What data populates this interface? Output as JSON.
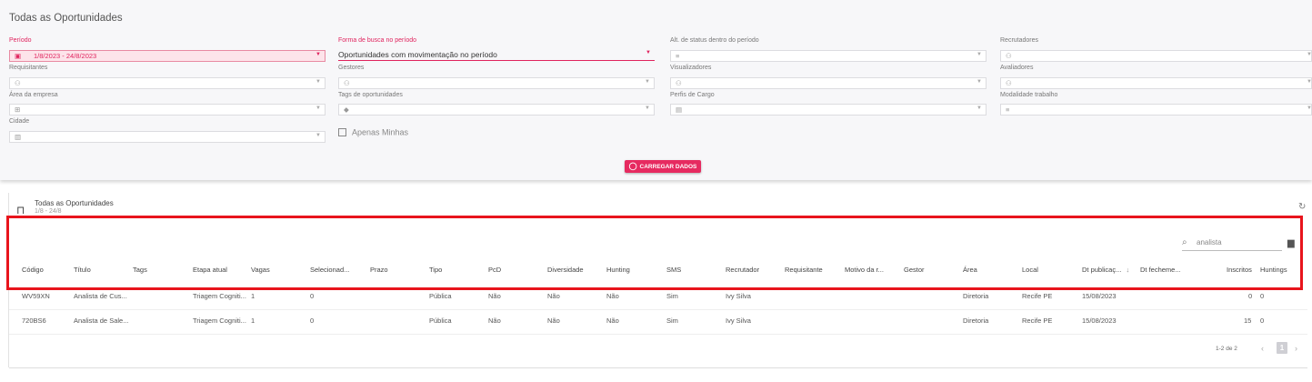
{
  "page": {
    "title": "Todas as Oportunidades"
  },
  "filters": {
    "periodo": {
      "label": "Período",
      "value": "1/8/2023 - 24/8/2023",
      "icon": "calendar-icon"
    },
    "forma_busca": {
      "label": "Forma de busca no período",
      "value": "Oportunidades com movimentação no período"
    },
    "alt_status": {
      "label": "Alt. de status dentro do período",
      "icon": "list-icon"
    },
    "recrutadores": {
      "label": "Recrutadores",
      "icon": "people-icon"
    },
    "requisitantes": {
      "label": "Requisitantes",
      "icon": "people-icon"
    },
    "gestores": {
      "label": "Gestores",
      "icon": "people-icon"
    },
    "visualizadores": {
      "label": "Visualizadores",
      "icon": "people-icon"
    },
    "avaliadores": {
      "label": "Avaliadores",
      "icon": "people-icon"
    },
    "area_empresa": {
      "label": "Área da empresa",
      "icon": "org-icon"
    },
    "tags": {
      "label": "Tags de oportunidades",
      "icon": "tag-icon"
    },
    "perfis": {
      "label": "Perfis de Cargo",
      "icon": "id-card-icon"
    },
    "modalidade": {
      "label": "Modalidade trabalho",
      "icon": "list-icon"
    },
    "cidade": {
      "label": "Cidade",
      "icon": "building-icon"
    },
    "apenas_minhas": {
      "label": "Apenas Minhas",
      "checked": false
    },
    "load_button": "CARREGAR DADOS"
  },
  "list": {
    "title": "Todas as Oportunidades",
    "subtitle": "1/8 - 24/8",
    "search_value": "analista",
    "headers": [
      "Código",
      "Título",
      "Tags",
      "Etapa atual",
      "Vagas",
      "Selecionad...",
      "Prazo",
      "Tipo",
      "PcD",
      "Diversidade",
      "Hunting",
      "SMS",
      "Recrutador",
      "Requisitante",
      "Motivo da r...",
      "Gestor",
      "Área",
      "Local",
      "Dt publicaç...",
      "Dt fecheme...",
      "Inscritos",
      "Huntings"
    ],
    "sorted_column": "Dt publicaç...",
    "rows": [
      {
        "codigo": "WV59XN",
        "titulo": "Analista de Cus...",
        "etapa": "Triagem Cogniti...",
        "vagas": "1",
        "selecionados": "0",
        "tipo": "Pública",
        "pcd": "Não",
        "diversidade": "Não",
        "hunting": "Não",
        "sms": "Sim",
        "recrutador": "Ivy Silva",
        "area": "Diretoria",
        "local": "Recife PE",
        "dt_publicacao": "15/08/2023",
        "inscritos": "0",
        "huntings": "0"
      },
      {
        "codigo": "720BS6",
        "titulo": "Analista de Sale...",
        "etapa": "Triagem Cogniti...",
        "vagas": "1",
        "selecionados": "0",
        "tipo": "Pública",
        "pcd": "Não",
        "diversidade": "Não",
        "hunting": "Não",
        "sms": "Sim",
        "recrutador": "Ivy Silva",
        "area": "Diretoria",
        "local": "Recife PE",
        "dt_publicacao": "15/08/2023",
        "inscritos": "15",
        "huntings": "0"
      }
    ],
    "pagination": {
      "range": "1-2 de 2",
      "current": "1"
    }
  },
  "colors": {
    "accent": "#e62a60",
    "highlight": "#e8141c"
  }
}
